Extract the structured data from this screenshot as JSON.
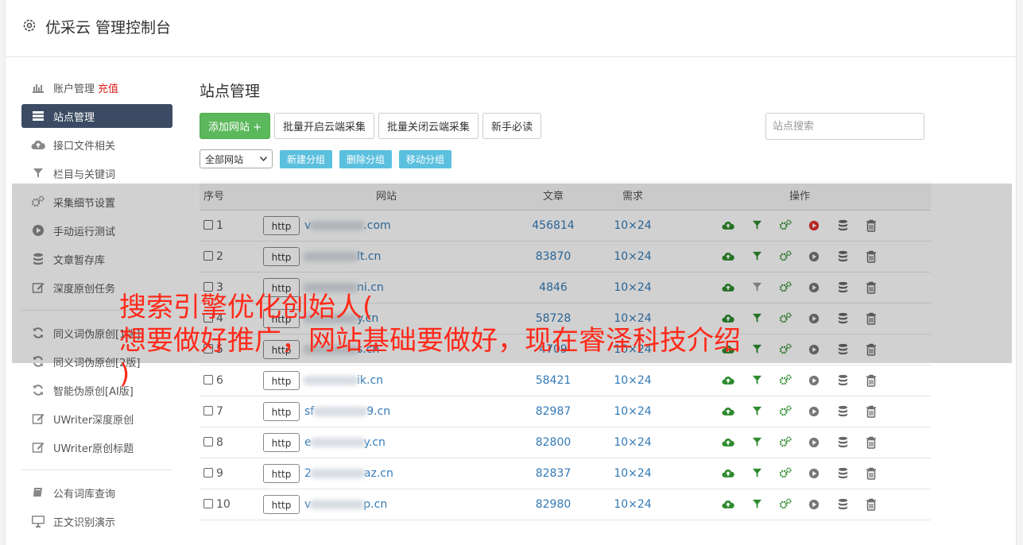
{
  "app": {
    "title": "优采云 管理控制台"
  },
  "sidebar": {
    "group1": [
      {
        "label": "账户管理",
        "extra": "充值",
        "icon": "bar-chart-icon"
      },
      {
        "label": "站点管理",
        "icon": "server-icon",
        "active": true
      },
      {
        "label": "接口文件相关",
        "icon": "cloud-upload-icon"
      },
      {
        "label": "栏目与关键词",
        "icon": "filter-icon"
      },
      {
        "label": "采集细节设置",
        "icon": "gears-icon"
      },
      {
        "label": "手动运行测试",
        "icon": "play-icon"
      },
      {
        "label": "文章暂存库",
        "icon": "database-icon"
      },
      {
        "label": "深度原创任务",
        "icon": "edit-icon"
      }
    ],
    "group2": [
      {
        "label": "同义词伪原创[1版]",
        "icon": "refresh-icon"
      },
      {
        "label": "同义词伪原创[2版]",
        "icon": "refresh-icon"
      },
      {
        "label": "智能伪原创[AI版]",
        "icon": "refresh-icon"
      },
      {
        "label": "UWriter深度原创",
        "icon": "edit-icon"
      },
      {
        "label": "UWriter原创标题",
        "icon": "edit-icon"
      }
    ],
    "group3": [
      {
        "label": "公有词库查询",
        "icon": "book-icon"
      },
      {
        "label": "正文识别演示",
        "icon": "monitor-icon"
      }
    ]
  },
  "main": {
    "title": "站点管理",
    "buttons": {
      "add": "添加网站 +",
      "batch_on": "批量开启云端采集",
      "batch_off": "批量关闭云端采集",
      "guide": "新手必读"
    },
    "search_placeholder": "站点搜索",
    "group_select": "全部网站",
    "group_buttons": {
      "new": "新建分组",
      "delete": "删除分组",
      "move": "移动分组"
    },
    "table": {
      "headers": {
        "idx": "序号",
        "site": "网站",
        "articles": "文章",
        "demand": "需求",
        "ops": "操作"
      },
      "http_label": "http",
      "rows": [
        {
          "idx": "1",
          "site_prefix": "v",
          "site_suffix": ".com",
          "articles": "456814",
          "demand": "10×24",
          "play_active": true,
          "filter_active": true
        },
        {
          "idx": "2",
          "site_prefix": "",
          "site_suffix": "lt.cn",
          "articles": "83870",
          "demand": "10×24",
          "play_active": false,
          "filter_active": true
        },
        {
          "idx": "3",
          "site_prefix": "",
          "site_suffix": "ni.cn",
          "articles": "4846",
          "demand": "10×24",
          "play_active": false,
          "filter_active": false
        },
        {
          "idx": "4",
          "site_prefix": "",
          "site_suffix": "y.cn",
          "articles": "58728",
          "demand": "10×24",
          "play_active": false,
          "filter_active": true
        },
        {
          "idx": "5",
          "site_prefix": "",
          "site_suffix": "s.cn",
          "articles": "4709",
          "demand": "10×24",
          "play_active": false,
          "filter_active": true
        },
        {
          "idx": "6",
          "site_prefix": "",
          "site_suffix": "ik.cn",
          "articles": "58421",
          "demand": "10×24",
          "play_active": false,
          "filter_active": true
        },
        {
          "idx": "7",
          "site_prefix": "sf",
          "site_suffix": "9.cn",
          "articles": "82987",
          "demand": "10×24",
          "play_active": false,
          "filter_active": true
        },
        {
          "idx": "8",
          "site_prefix": "e",
          "site_suffix": "y.cn",
          "articles": "82800",
          "demand": "10×24",
          "play_active": false,
          "filter_active": true
        },
        {
          "idx": "9",
          "site_prefix": "2",
          "site_suffix": "az.cn",
          "articles": "82837",
          "demand": "10×24",
          "play_active": false,
          "filter_active": true
        },
        {
          "idx": "10",
          "site_prefix": "v",
          "site_suffix": "p.cn",
          "articles": "82980",
          "demand": "10×24",
          "play_active": false,
          "filter_active": true
        }
      ]
    }
  },
  "banner": {
    "text": "搜索引擎优化创始人(\n想要做好推广，网站基础要做好，现在睿泽科技介绍\n)"
  },
  "colors": {
    "green": "#5cb85c",
    "info": "#5bc0de",
    "link": "#337ab7",
    "banner": "#ff2a1a",
    "sidebar_active": "#3c4b63"
  }
}
